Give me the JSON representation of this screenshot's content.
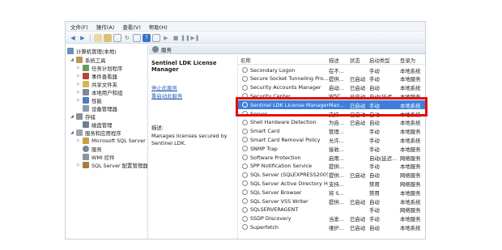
{
  "menu": [
    "文件(F)",
    "操作(A)",
    "查看(V)",
    "帮助(H)"
  ],
  "toolbar_icons": [
    "back-icon",
    "forward-icon",
    "up-icon",
    "folder-icon",
    "properties-icon",
    "refresh-icon",
    "export-icon",
    "help-icon",
    "console-icon",
    "play-icon",
    "stop-icon",
    "pause-icon",
    "restart-icon"
  ],
  "tree": {
    "root": "计算机管理(本地)",
    "system_tools": "系统工具",
    "task_scheduler": "任务计划程序",
    "event_viewer": "事件查看器",
    "shared_folders": "共享文件夹",
    "local_users": "本地用户和组",
    "performance": "性能",
    "device_manager": "设备管理器",
    "storage": "存储",
    "disk_management": "磁盘管理",
    "services_apps": "服务和应用程序",
    "sql_server": "Microsoft SQL Server",
    "services": "服务",
    "wmi": "WMI 控件",
    "sql_config": "SQL Server 配置管理器"
  },
  "main": {
    "header": "服务",
    "desc_title": "Sentinel LDK License Manager",
    "desc_link": "停止此服务",
    "desc_link2": "重启动此服务",
    "desc_label": "描述:",
    "desc_text": "Manages licenses secured by Sentinel LDK."
  },
  "columns": [
    "名称",
    "描述",
    "状态",
    "启动类型",
    "登录为"
  ],
  "services": [
    {
      "name": "Secondary Logon",
      "desc": "在不...",
      "status": "",
      "start": "手动",
      "logon": "本地系统"
    },
    {
      "name": "Secure Socket Tunneling Pro...",
      "desc": "提供...",
      "status": "已启动",
      "start": "手动",
      "logon": "本地服务"
    },
    {
      "name": "Security Accounts Manager",
      "desc": "启动...",
      "status": "已启动",
      "start": "自动",
      "logon": "本地系统"
    },
    {
      "name": "Security Center",
      "desc": "WSC...",
      "status": "已启动",
      "start": "自动(延迟...",
      "logon": "本地服务"
    },
    {
      "name": "Sentinel LDK License Manager",
      "desc": "Man...",
      "status": "已启动",
      "start": "手动",
      "logon": "本地系统"
    },
    {
      "name": "Server",
      "desc": "支持...",
      "status": "已启动",
      "start": "自动",
      "logon": "本地系统"
    },
    {
      "name": "Shell Hardware Detection",
      "desc": "为自...",
      "status": "已启动",
      "start": "自动",
      "logon": "本地系统"
    },
    {
      "name": "Smart Card",
      "desc": "管理...",
      "status": "",
      "start": "手动",
      "logon": "本地服务"
    },
    {
      "name": "Smart Card Removal Policy",
      "desc": "允许...",
      "status": "",
      "start": "手动",
      "logon": "本地系统"
    },
    {
      "name": "SNMP Trap",
      "desc": "接收...",
      "status": "",
      "start": "手动",
      "logon": "本地服务"
    },
    {
      "name": "Software Protection",
      "desc": "启用...",
      "status": "",
      "start": "自动(延迟...",
      "logon": "网络服务"
    },
    {
      "name": "SPP Notification Service",
      "desc": "提供...",
      "status": "",
      "start": "手动",
      "logon": "本地服务"
    },
    {
      "name": "SQL Server (SQLEXPRESS2005)",
      "desc": "提供...",
      "status": "已启动",
      "start": "自动",
      "logon": "网络服务"
    },
    {
      "name": "SQL Server Active Directory H...",
      "desc": "支持...",
      "status": "",
      "start": "禁用",
      "logon": "网络服务"
    },
    {
      "name": "SQL Server Browser",
      "desc": "将 S...",
      "status": "",
      "start": "禁用",
      "logon": "本地服务"
    },
    {
      "name": "SQL Server VSS Writer",
      "desc": "提供...",
      "status": "已启动",
      "start": "自动",
      "logon": "本地系统"
    },
    {
      "name": "SQLSERVERAGENT",
      "desc": "",
      "status": "",
      "start": "手动",
      "logon": "网络服务"
    },
    {
      "name": "SSDP Discovery",
      "desc": "当发...",
      "status": "已启动",
      "start": "手动",
      "logon": "本地服务"
    },
    {
      "name": "Superfetch",
      "desc": "维护...",
      "status": "已启动",
      "start": "自动",
      "logon": "本地系统"
    }
  ],
  "selected_index": 4,
  "highlight_color": "#e20f0f",
  "selection_color": "#3d7fd8"
}
